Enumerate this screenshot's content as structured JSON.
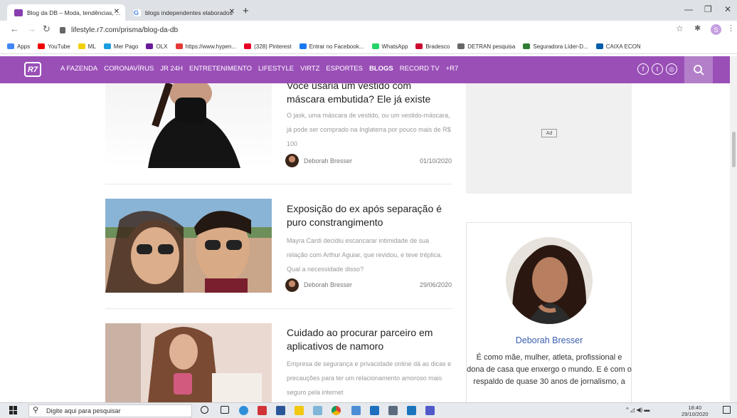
{
  "browser": {
    "tabs": [
      {
        "label": "Blog da DB – Moda, tendências, ...",
        "favicon_color": "#8a3fb0"
      },
      {
        "label": "blogs independentes elaborados",
        "favicon_color": "#4285f4"
      }
    ],
    "url": "lifestyle.r7.com/prisma/blog-da-db",
    "profile_initial": "S",
    "bookmarks": [
      {
        "label": "Apps",
        "color": "#4285f4"
      },
      {
        "label": "YouTube",
        "color": "#e00"
      },
      {
        "label": "ML",
        "color": "#f0d000"
      },
      {
        "label": "Mer Pago",
        "color": "#1b9ee0"
      },
      {
        "label": "OLX",
        "color": "#6a1b9a"
      },
      {
        "label": "https://www.hypen...",
        "color": "#e53935"
      },
      {
        "label": "(328) Pinterest",
        "color": "#e60023"
      },
      {
        "label": "Entrar no Facebook...",
        "color": "#1877f2"
      },
      {
        "label": "WhatsApp",
        "color": "#25d366"
      },
      {
        "label": "Bradesco",
        "color": "#cc092f"
      },
      {
        "label": "DETRAN pesquisa",
        "color": "#666666"
      },
      {
        "label": "Seguradora Líder-D...",
        "color": "#2e7d32"
      },
      {
        "label": "CAIXA ECON",
        "color": "#005ca9"
      }
    ]
  },
  "site": {
    "logo": "R7",
    "brand_color": "#9a4fb7",
    "nav": [
      "A FAZENDA",
      "CORONAVÍRUS",
      "JR 24H",
      "ENTRETENIMENTO",
      "LIFESTYLE",
      "VIRTZ",
      "ESPORTES",
      "BLOGS",
      "RECORD TV",
      "+R7"
    ],
    "nav_active": "BLOGS",
    "social_icons": [
      "facebook-icon",
      "twitter-icon",
      "instagram-icon"
    ]
  },
  "posts": [
    {
      "title": "Você usaria um vestido com máscara embutida? Ele já existe",
      "excerpt": "O jask, uma máscara de vestido, ou um vestido-máscara, já pode ser comprado na Inglaterra por pouco mais de R$ 100",
      "author": "Deborah Bresser",
      "date": "01/10/2020"
    },
    {
      "title": "Exposição do ex após separação é puro constrangimento",
      "excerpt": "Mayra Cardi decidiu escancarar intimidade de sua relação com Arthur Aguiar, que revidou, e teve tréplica. Qual a necessidade disso?",
      "author": "Deborah Bresser",
      "date": "29/06/2020"
    },
    {
      "title": "Cuidado ao procurar parceiro em aplicativos de namoro",
      "excerpt": "Empresa de segurança e privacidade online dá as dicas e precauções para ter um relacionamento amoroso mais seguro pela internet"
    }
  ],
  "sidebar": {
    "ad_label": "Ad",
    "author_name": "Deborah Bresser",
    "author_bio": "É como mãe, mulher, atleta, profissional e dona de casa que enxergo o mundo. E é com o respaldo de quase 30 anos de jornalismo, a"
  },
  "taskbar": {
    "search_placeholder": "Digite aqui para pesquisar",
    "time": "18:40",
    "date": "29/10/2020"
  }
}
